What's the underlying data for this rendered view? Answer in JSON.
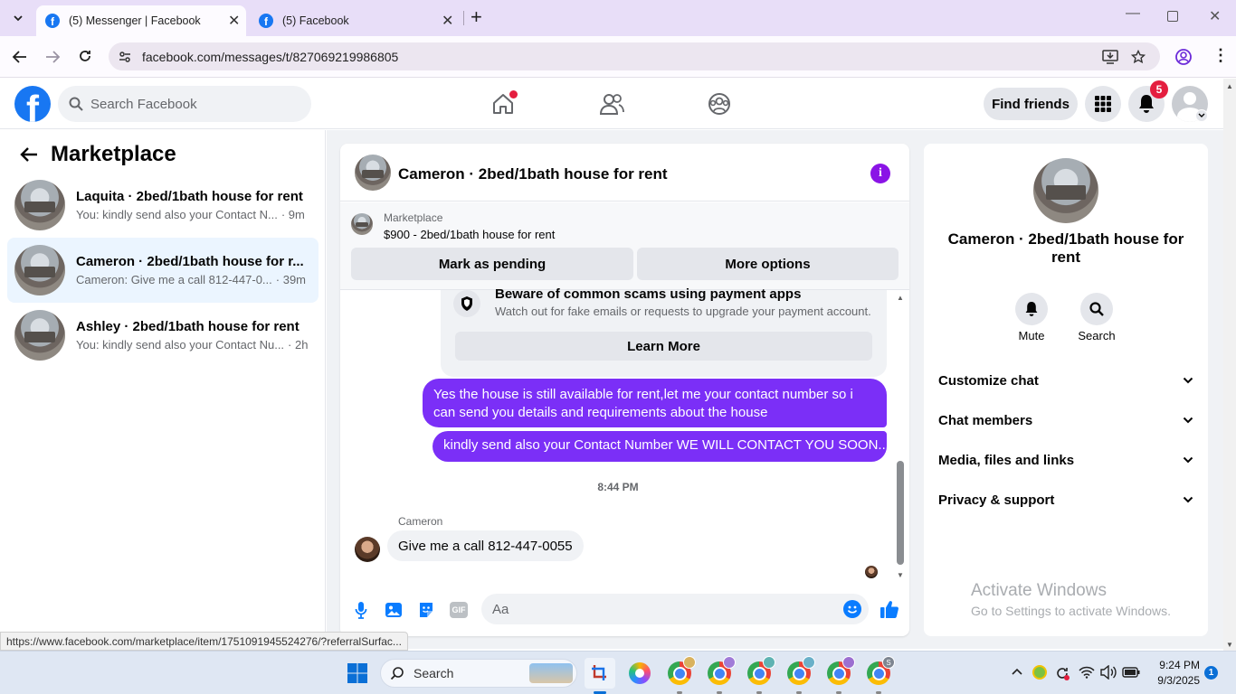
{
  "browser": {
    "tabs": [
      {
        "title": "(5) Messenger | Facebook",
        "active": true
      },
      {
        "title": "(5) Facebook",
        "active": false
      }
    ],
    "url": "facebook.com/messages/t/827069219986805",
    "status_url": "https://www.facebook.com/marketplace/item/1751091945524276/?referralSurfac..."
  },
  "fb": {
    "search_placeholder": "Search Facebook",
    "find_friends": "Find friends",
    "notifications_count": "5"
  },
  "sidebar": {
    "title": "Marketplace",
    "conversations": [
      {
        "name": "Laquita · 2bed/1bath house for rent",
        "preview": "You: kindly send also your Contact N...",
        "time": "· 9m"
      },
      {
        "name": "Cameron · 2bed/1bath house for r...",
        "preview": "Cameron: Give me a call 812-447-0...",
        "time": "· 39m"
      },
      {
        "name": "Ashley · 2bed/1bath house for rent",
        "preview": "You: kindly send also your Contact Nu...",
        "time": "· 2h"
      }
    ]
  },
  "chat": {
    "title": "Cameron · 2bed/1bath house for rent",
    "listing": {
      "label": "Marketplace",
      "price_title": "$900 - 2bed/1bath house for rent",
      "mark_pending": "Mark as pending",
      "more_options": "More options"
    },
    "scam_notice": {
      "title": "Beware of common scams using payment apps",
      "body": "Watch out for fake emails or requests to upgrade your payment account.",
      "button": "Learn More"
    },
    "outgoing": [
      "Yes the house is still available for rent,let me your contact number so i can send you details and requirements about the house",
      "kindly send also your Contact Number  WE WILL CONTACT YOU SOON..."
    ],
    "timestamp": "8:44 PM",
    "incoming": {
      "sender": "Cameron",
      "text": "Give me a call 812-447-0055"
    },
    "composer_placeholder": "Aa"
  },
  "details": {
    "name": "Cameron · 2bed/1bath house for rent",
    "mute": "Mute",
    "search": "Search",
    "sections": [
      "Customize chat",
      "Chat members",
      "Media, files and links",
      "Privacy & support"
    ]
  },
  "watermark": {
    "title": "Activate Windows",
    "subtitle": "Go to Settings to activate Windows."
  },
  "taskbar": {
    "search": "Search",
    "time": "9:24 PM",
    "date": "9/3/2025",
    "notif_count": "1"
  },
  "colors": {
    "fb_blue": "#1877f2",
    "messenger_purple": "#7b2ff7",
    "selected_row": "#ebf5ff",
    "notif_red": "#e41e3f"
  }
}
